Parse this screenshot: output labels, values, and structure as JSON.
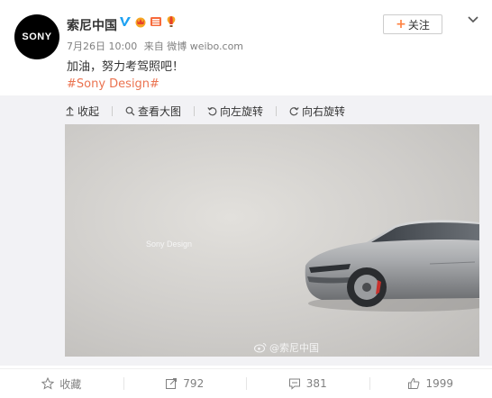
{
  "account": {
    "avatar_text": "SONY",
    "name": "索尼中国",
    "verified_badge": "V",
    "date": "7月26日 10:00",
    "source": "来自 微博 weibo.com"
  },
  "follow_button": {
    "icon": "+",
    "label": "关注"
  },
  "post": {
    "text": "加油，努力考驾照吧！",
    "hashtag": "#Sony Design#"
  },
  "media_toolbar": {
    "collapse": "收起",
    "view_large": "查看大图",
    "rotate_left": "向左旋转",
    "rotate_right": "向右旋转"
  },
  "image": {
    "caption": "Sony Design",
    "watermark": "@索尼中国"
  },
  "actions": {
    "favorite": "收藏",
    "repost_count": "792",
    "comment_count": "381",
    "like_count": "1999"
  },
  "colors": {
    "hashtag": "#eb7350",
    "follow_plus": "#ff8140",
    "muted": "#808080"
  }
}
